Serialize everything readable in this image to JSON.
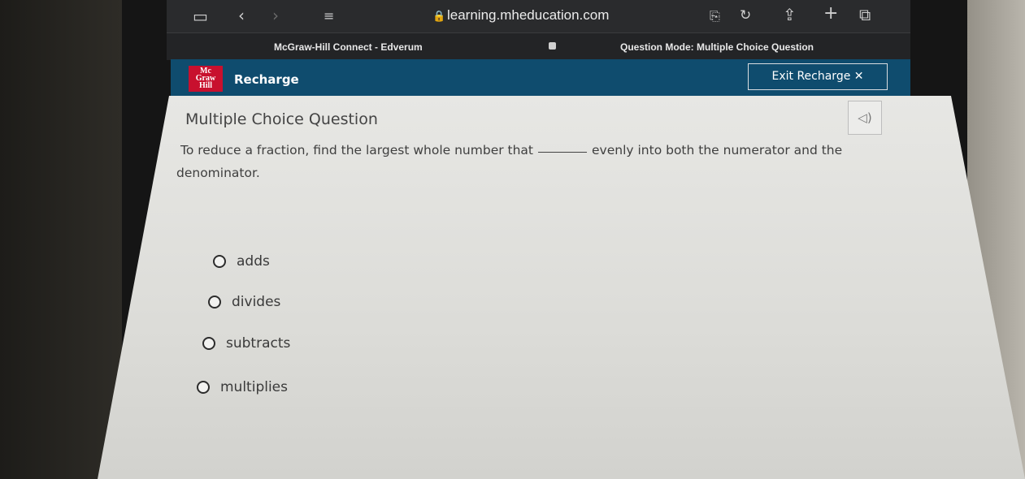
{
  "browser": {
    "url": "learning.mheducation.com",
    "tabs": [
      {
        "label": "McGraw-Hill Connect - Edverum"
      },
      {
        "label": "Question Mode: Multiple Choice Question"
      }
    ]
  },
  "header": {
    "logo_text": "Mc Graw Hill",
    "title": "Recharge",
    "exit_label": "Exit Recharge ✕"
  },
  "question": {
    "heading": "Multiple Choice Question",
    "prompt_before": "To reduce a fraction, find the largest whole number that",
    "prompt_after": "evenly into both the numerator and the",
    "prompt_line2": "denominator.",
    "options": [
      {
        "label": "adds"
      },
      {
        "label": "divides"
      },
      {
        "label": "subtracts"
      },
      {
        "label": "multiplies"
      }
    ]
  }
}
